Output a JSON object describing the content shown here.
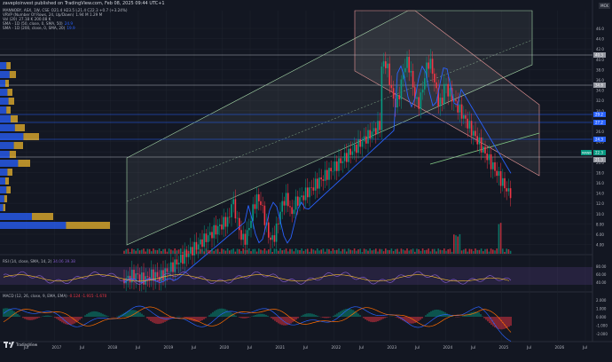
{
  "header": {
    "published": "zaveploinvest published on TradingView.com, Feb 08, 2025 09:44 UTC+1",
    "ticker_badge": "MCK"
  },
  "legend": {
    "symbol_line": "MANNOBY, ASX, 1W, CSE",
    "symbol_values": "O21.4 H23.5 L21.4 C22.3 +0.7 (+3.24%)",
    "vrvp_line": "VRVP (Number Of Rows, 24, Up/Down)",
    "vrvp_values": "1.94 M  1.29 M",
    "vol_line": "Vol (20)",
    "vol_values": "27.18 K  200.08 K",
    "sma50_line": "SMA - 1D (50, close, 0, SMA, 50)",
    "sma50_value": "24.9",
    "sma200_line": "SMA - 1D (200, close, 0, SMA, 20)",
    "sma200_value": "19.9"
  },
  "price_axis": {
    "ticks": [
      "46.0",
      "44.0",
      "42.0",
      "40.0",
      "38.0",
      "36.0",
      "34.0",
      "32.0",
      "30.0",
      "28.0",
      "26.0",
      "24.0",
      "22.0",
      "20.0",
      "18.0",
      "16.0",
      "14.0",
      "12.0",
      "10.0",
      "8.00",
      "6.00",
      "4.00"
    ],
    "markers": [
      {
        "label": "40.3",
        "price": 40.3,
        "color": "#9598a1"
      },
      {
        "label": "34.8",
        "price": 34.8,
        "color": "#9598a1"
      },
      {
        "label": "29.2",
        "price": 29.2,
        "color": "#2962ff"
      },
      {
        "label": "27.2",
        "price": 27.2,
        "color": "#2962ff"
      },
      {
        "label": "24.3",
        "price": 24.3,
        "color": "#2962ff"
      },
      {
        "label": "22.3",
        "price": 22.3,
        "color": "#089981"
      },
      {
        "label": "21.3",
        "price": 21.3,
        "color": "#9598a1"
      }
    ],
    "sym_tag": "MANN"
  },
  "rsi": {
    "legend": "RSI (14, close, SMA, 14, 2)",
    "values": "34.06  39.38",
    "ticks": [
      "80.00",
      "60.00",
      "40.00"
    ]
  },
  "macd": {
    "legend": "MACD (12, 26, close, 9, EMA, EMA)",
    "values": "-0.124  -1.915  -1.670",
    "ticks": [
      "2.000",
      "1.000",
      "0.000",
      "-1.000",
      "-2.000"
    ]
  },
  "time_axis": {
    "labels": [
      "Jul",
      "2017",
      "Jul",
      "2018",
      "Jul",
      "2019",
      "Jul",
      "2020",
      "Jul",
      "2021",
      "Jul",
      "2022",
      "Jul",
      "2023",
      "Jul",
      "2024",
      "Jul",
      "2025",
      "Jul",
      "2026",
      "Jul"
    ]
  },
  "footer": {
    "brand": "TradingView"
  },
  "colors": {
    "bg": "#131722",
    "up": "#089981",
    "down": "#f23645",
    "sma": "#2962ff",
    "grid": "#1e222d",
    "rsi": "#7e57c2",
    "macd_signal": "#ff6d00"
  }
}
